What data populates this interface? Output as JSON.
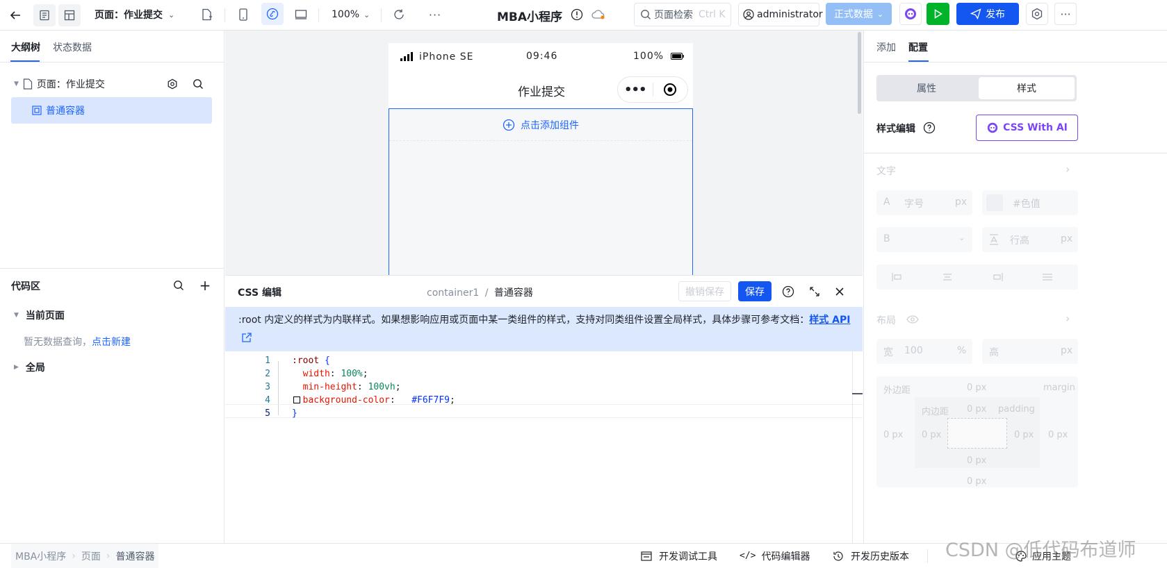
{
  "topbar": {
    "page_selector": "页面：作业提交",
    "zoom": "100%",
    "app_title": "MBA小程序",
    "search_placeholder": "页面检索",
    "search_shortcut": "Ctrl K",
    "user": "administrator",
    "env": "正式数据",
    "publish": "发布"
  },
  "left_panel": {
    "tabs": [
      "大纲树",
      "状态数据"
    ],
    "tree": {
      "page_node": "页面：作业提交",
      "child_node": "普通容器"
    },
    "code_area": {
      "title": "代码区",
      "current_page": "当前页面",
      "empty_text": "暂无数据查询，",
      "create_link": "点击新建",
      "global": "全局"
    }
  },
  "phone": {
    "device": "iPhone SE",
    "time": "09:46",
    "battery": "100%",
    "title": "作业提交",
    "add_component": "点击添加组件"
  },
  "editor": {
    "title": "CSS 编辑",
    "crumb_id": "container1",
    "crumb_sep": "/",
    "crumb_name": "普通容器",
    "undo_save": "撤销保存",
    "save": "保存",
    "notice": ":root 内定义的样式为内联样式。如果想影响应用或页面中某一类组件的样式，支持对同类组件设置全局样式，具体步骤可参考文档：",
    "notice_link": "样式 API",
    "code": [
      {
        "n": "1",
        "parts": [
          {
            "t": ":root ",
            "c": "sel"
          },
          {
            "t": "{",
            "c": "brace"
          }
        ]
      },
      {
        "n": "2",
        "parts": [
          {
            "t": "  width",
            "c": "prop"
          },
          {
            "t": ": ",
            "c": "plain"
          },
          {
            "t": "100%",
            "c": "val"
          },
          {
            "t": ";",
            "c": "plain"
          }
        ]
      },
      {
        "n": "3",
        "parts": [
          {
            "t": "  min-height",
            "c": "prop"
          },
          {
            "t": ": ",
            "c": "plain"
          },
          {
            "t": "100vh",
            "c": "val"
          },
          {
            "t": ";",
            "c": "plain"
          }
        ]
      },
      {
        "n": "4",
        "parts": [
          {
            "t": "  background-color",
            "c": "prop"
          },
          {
            "t": ": ",
            "c": "plain"
          },
          {
            "t": "  ",
            "c": "plain"
          },
          {
            "t": "#F6F7F9",
            "c": "brace"
          },
          {
            "t": ";",
            "c": "plain"
          }
        ]
      },
      {
        "n": "5",
        "parts": [
          {
            "t": "}",
            "c": "brace"
          }
        ]
      }
    ],
    "swatch_color": "#F6F7F9"
  },
  "right_panel": {
    "tabs": [
      "添加",
      "配置"
    ],
    "segments": [
      "属性",
      "样式"
    ],
    "style_edit": "样式编辑",
    "css_ai": "CSS With AI",
    "text_section": "文字",
    "font_prefix": "A",
    "font_size_placeholder": "字号",
    "font_unit": "px",
    "color_placeholder": "#色值",
    "bold_prefix": "B",
    "line_height_placeholder": "行高",
    "line_unit": "px",
    "layout_section": "布局",
    "width_label": "宽",
    "width_value": "100",
    "width_unit": "%",
    "height_label": "高",
    "height_unit": "px",
    "margin_label": "外边距",
    "margin_en": "margin",
    "padding_label": "内边距",
    "padding_en": "padding",
    "zero": "0 px"
  },
  "bottombar": {
    "breadcrumbs": [
      "MBA小程序",
      "页面",
      "普通容器"
    ],
    "tools": [
      "开发调试工具",
      "代码编辑器",
      "开发历史版本"
    ],
    "theme": "应用主题",
    "watermark": "CSDN @低代码布道师"
  },
  "colors": {
    "primary": "#1f64ff",
    "publish_bg": "#1456f0",
    "run_bg": "#00b42a",
    "env_bg": "#94bff6",
    "selected_bg": "#d9e6fd",
    "notice_bg": "#dbe8fd"
  }
}
